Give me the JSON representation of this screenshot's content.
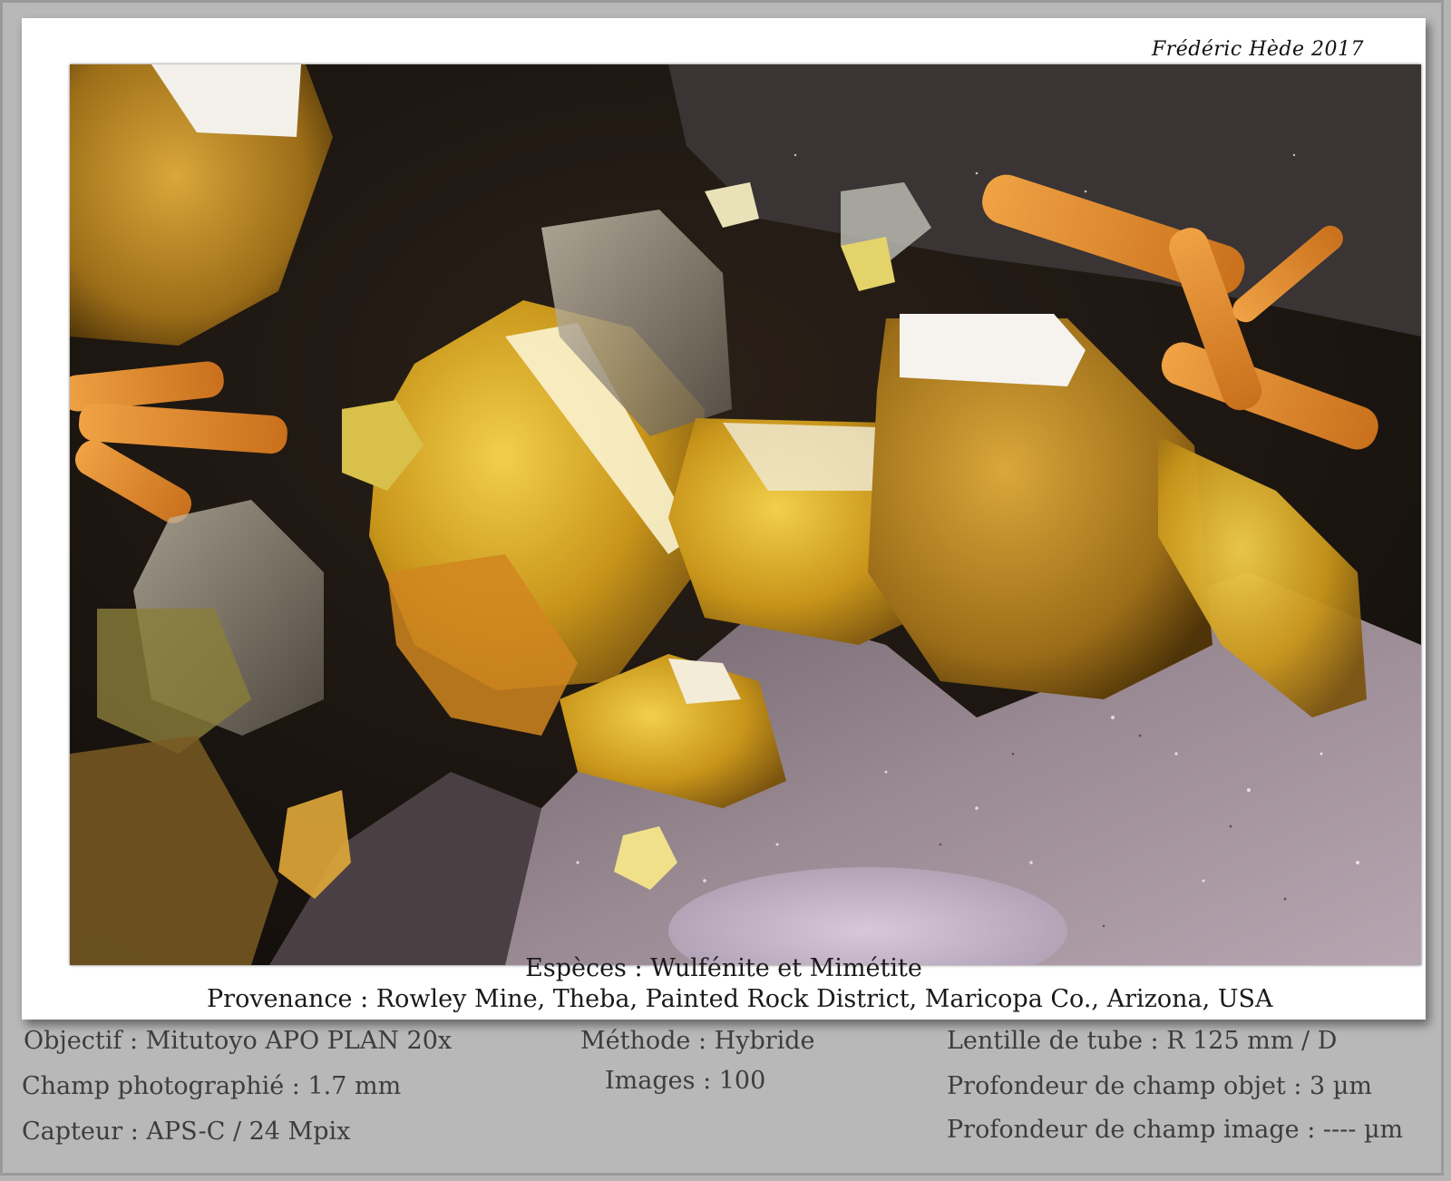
{
  "signature": "Frédéric Hède 2017",
  "photo": {
    "subject": "mineral-specimen-photo",
    "colors": {
      "crystal_yellow": "#d9a91e",
      "crystal_orange": "#e08a2a",
      "matrix_lilac": "#a8969f",
      "background_dark": "#1e1812"
    }
  },
  "caption": {
    "species": "Espèces : Wulfénite et Mimétite",
    "provenance": "Provenance : Rowley Mine, Theba, Painted Rock District, Maricopa Co., Arizona, USA"
  },
  "technical": {
    "objectif": "Objectif : Mitutoyo APO PLAN 20x",
    "champ": "Champ photographié : 1.7 mm",
    "capteur": "Capteur : APS-C / 24 Mpix",
    "methode": "Méthode : Hybride",
    "images": "Images : 100",
    "lentille": "Lentille de tube : R 125 mm / D",
    "profondeur_objet": "Profondeur de champ objet : 3 µm",
    "profondeur_image": "Profondeur de champ image : ---- µm"
  }
}
